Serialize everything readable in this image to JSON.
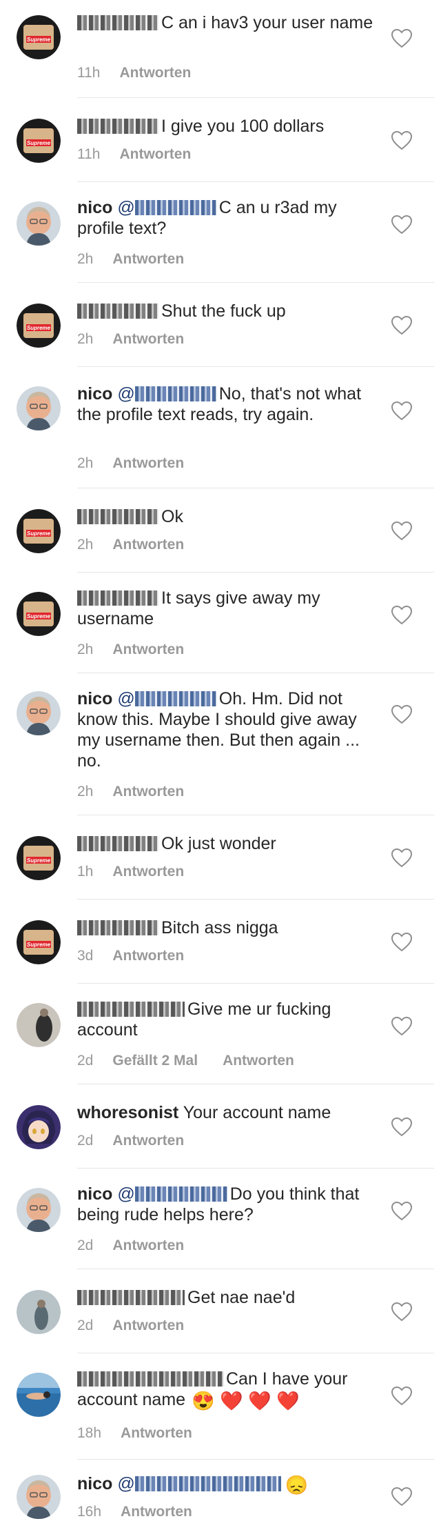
{
  "comments": [
    {
      "author": "",
      "mention": "",
      "masked": "user",
      "text": "C an i hav3 your user name",
      "time": "11h",
      "likes": "",
      "reply": "Antworten",
      "avatar": "supreme"
    },
    {
      "author": "",
      "mention": "",
      "masked": "user",
      "text": "I give you 100 dollars",
      "time": "11h",
      "likes": "",
      "reply": "Antworten",
      "avatar": "supreme"
    },
    {
      "author": "nico",
      "mention": "@",
      "masked": "mention",
      "text": "C an u r3ad my profile text?",
      "time": "2h",
      "likes": "",
      "reply": "Antworten",
      "avatar": "nico"
    },
    {
      "author": "",
      "mention": "",
      "masked": "user",
      "text": "Shut the fuck up",
      "time": "2h",
      "likes": "",
      "reply": "Antworten",
      "avatar": "supreme"
    },
    {
      "author": "nico",
      "mention": "@",
      "masked": "mention",
      "text": "No, that's not what the profile text reads, try again.",
      "time": "2h",
      "likes": "",
      "reply": "Antworten",
      "avatar": "nico"
    },
    {
      "author": "",
      "mention": "",
      "masked": "user",
      "text": "Ok",
      "time": "2h",
      "likes": "",
      "reply": "Antworten",
      "avatar": "supreme"
    },
    {
      "author": "",
      "mention": "",
      "masked": "user",
      "text": "It says give away my username",
      "time": "2h",
      "likes": "",
      "reply": "Antworten",
      "avatar": "supreme"
    },
    {
      "author": "nico",
      "mention": "@",
      "masked": "mention",
      "text": "Oh. Hm. Did not know this. Maybe I should give away my username then. But then again ... no.",
      "time": "2h",
      "likes": "",
      "reply": "Antworten",
      "avatar": "nico"
    },
    {
      "author": "",
      "mention": "",
      "masked": "user",
      "text": "Ok just wonder",
      "time": "1h",
      "likes": "",
      "reply": "Antworten",
      "avatar": "supreme"
    },
    {
      "author": "",
      "mention": "",
      "masked": "user",
      "text": "Bitch ass nigga",
      "time": "3d",
      "likes": "",
      "reply": "Antworten",
      "avatar": "supreme"
    },
    {
      "author": "",
      "mention": "",
      "masked": "user",
      "text": "Give me ur fucking account",
      "time": "2d",
      "likes": "Gefällt 2 Mal",
      "reply": "Antworten",
      "avatar": "gray"
    },
    {
      "author": "whoresonist",
      "mention": "",
      "masked": "",
      "text": "Your account name",
      "time": "2d",
      "likes": "",
      "reply": "Antworten",
      "avatar": "anime"
    },
    {
      "author": "nico",
      "mention": "@",
      "masked": "mention",
      "text": "Do you think that being rude helps here?",
      "time": "2d",
      "likes": "",
      "reply": "Antworten",
      "avatar": "nico"
    },
    {
      "author": "",
      "mention": "",
      "masked": "user",
      "text": "Get nae nae'd",
      "time": "2d",
      "likes": "",
      "reply": "Antworten",
      "avatar": "gray2"
    },
    {
      "author": "",
      "mention": "",
      "masked": "user",
      "text": "Can I have your account name",
      "emoji": "😍 ❤️ ❤️ ❤️",
      "time": "18h",
      "likes": "",
      "reply": "Antworten",
      "avatar": "swim"
    },
    {
      "author": "nico",
      "mention": "@",
      "masked": "mention",
      "text": "",
      "emoji": "😞",
      "time": "16h",
      "likes": "",
      "reply": "Antworten",
      "avatar": "nico"
    }
  ],
  "colors": {
    "text": "#262626",
    "meta": "#999999",
    "mention": "#1e3a72",
    "divider": "#e6e6e6"
  },
  "icons": {
    "like": "heart-outline-icon"
  }
}
